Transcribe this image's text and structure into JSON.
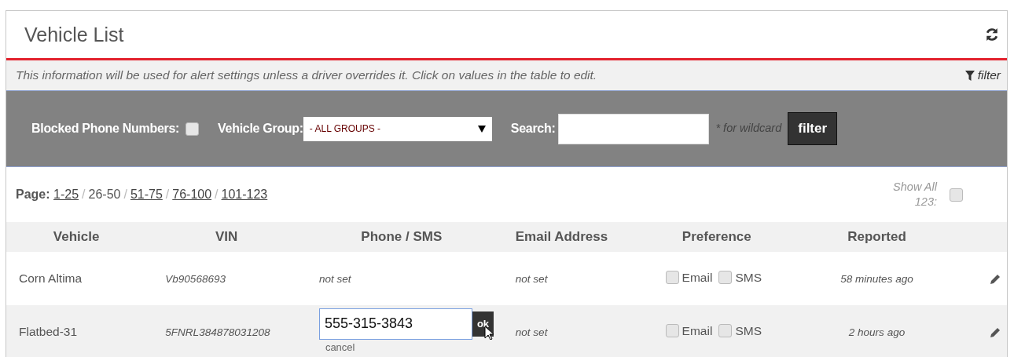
{
  "panel": {
    "title": "Vehicle List",
    "info": "This information will be used for alert settings unless a driver overrides it. Click on values in the table to edit.",
    "filter_toggle": "filter"
  },
  "filter_bar": {
    "blocked_label": "Blocked Phone Numbers:",
    "blocked_checked": false,
    "group_label": "Vehicle Group:",
    "group_value": "- ALL GROUPS -",
    "search_label": "Search:",
    "wildcard_hint": "* for wildcard",
    "filter_button": "filter"
  },
  "pagination": {
    "label": "Page:",
    "items": [
      {
        "kind": "page",
        "text": "1-25",
        "selected": false
      },
      {
        "kind": "separator",
        "text": "/"
      },
      {
        "kind": "page",
        "text": "26-50",
        "selected": true
      },
      {
        "kind": "separator",
        "text": "/"
      },
      {
        "kind": "page",
        "text": "51-75",
        "selected": false
      },
      {
        "kind": "separator",
        "text": "/"
      },
      {
        "kind": "page",
        "text": "76-100",
        "selected": false
      },
      {
        "kind": "separator",
        "text": "/"
      },
      {
        "kind": "page",
        "text": "101-123",
        "selected": false
      }
    ],
    "show_all_label": "Show All 123:",
    "show_all_checked": false
  },
  "table": {
    "columns": [
      "Vehicle",
      "VIN",
      "Phone / SMS",
      "Email Address",
      "Preference",
      "Reported"
    ],
    "rows": [
      {
        "vehicle": "Corn Altima",
        "vin": "Vb90568693",
        "phone": {
          "kind": "text",
          "text": "not set"
        },
        "email": "not set",
        "pref_email": {
          "label": "Email",
          "checked": false
        },
        "pref_sms": {
          "label": "SMS",
          "checked": false
        },
        "reported": "58 minutes ago"
      },
      {
        "vehicle": "Flatbed-31",
        "vin": "5FNRL384878031208",
        "phone": {
          "kind": "edit",
          "value": "555-315-3843",
          "ok": "ok",
          "cancel": "cancel"
        },
        "email": "not set",
        "pref_email": {
          "label": "Email",
          "checked": false
        },
        "pref_sms": {
          "label": "SMS",
          "checked": false
        },
        "reported": "2 hours ago"
      }
    ]
  }
}
